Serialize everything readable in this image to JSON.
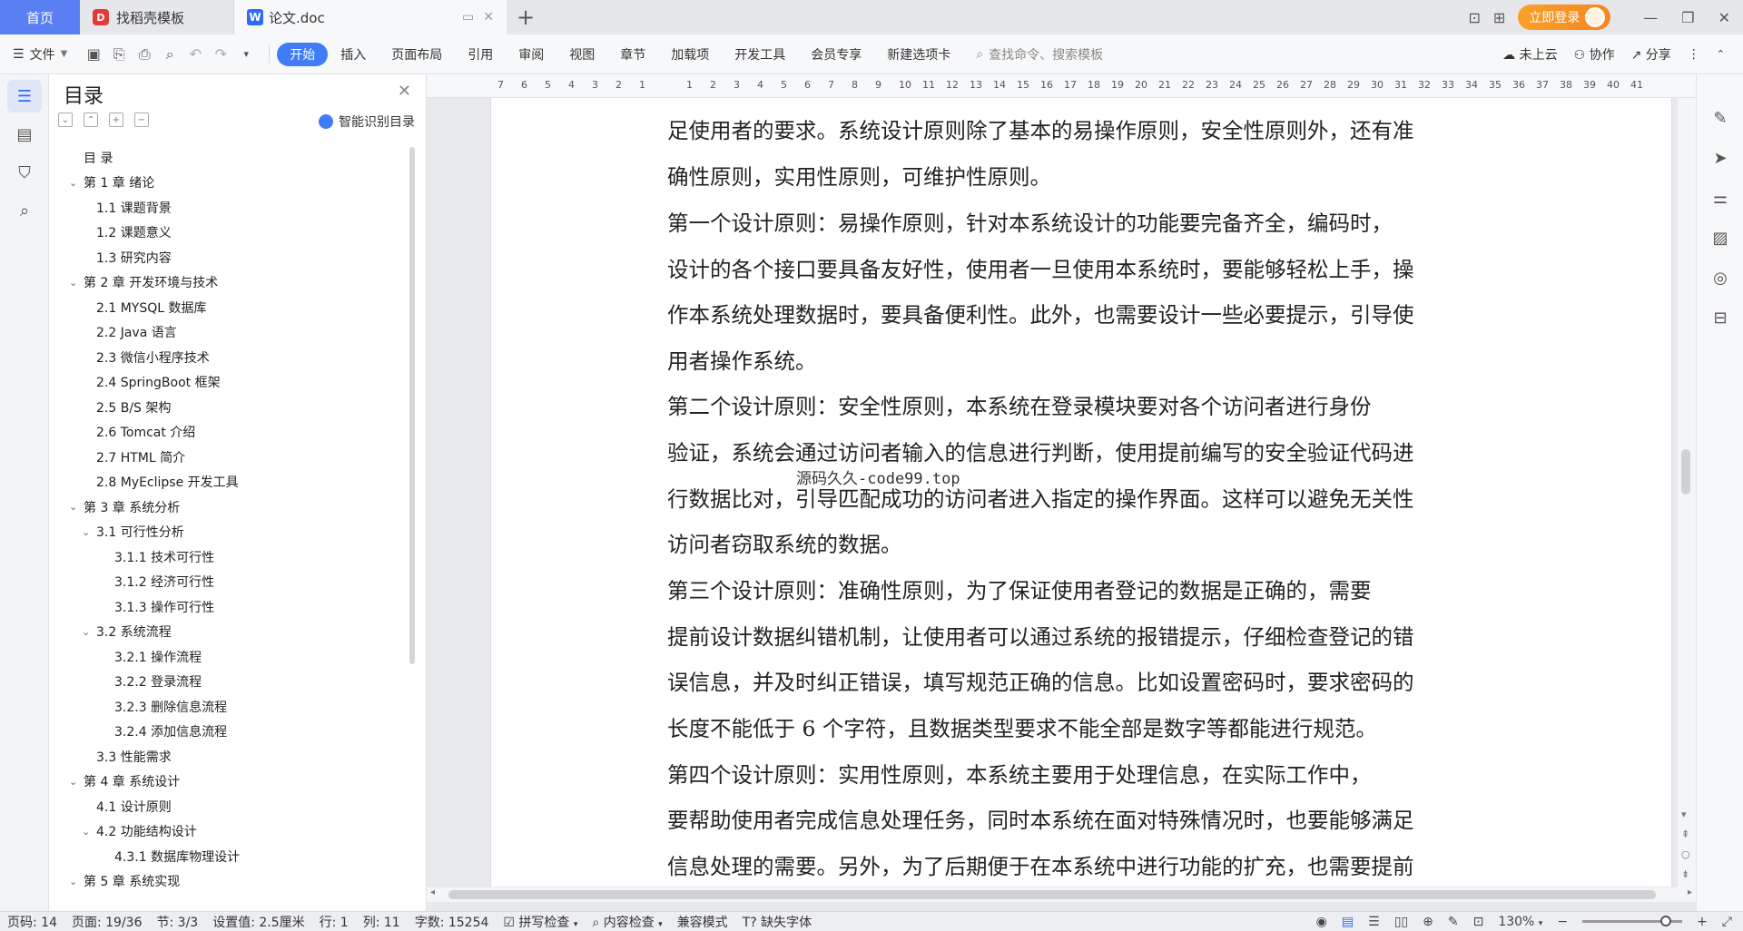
{
  "tabs": {
    "home": "首页",
    "template": "找稻壳模板",
    "document": "论文.doc",
    "add": "+"
  },
  "titlebar": {
    "login": "立即登录"
  },
  "toolbar": {
    "file_menu": "文件",
    "ribbon": [
      "开始",
      "插入",
      "页面布局",
      "引用",
      "审阅",
      "视图",
      "章节",
      "加载项",
      "开发工具",
      "会员专享",
      "新建选项卡"
    ],
    "search_placeholder": "查找命令、搜索模板",
    "cloud": "未上云",
    "collab": "协作",
    "share": "分享"
  },
  "toc": {
    "title": "目录",
    "smart_button": "智能识别目录",
    "items": [
      "目  录",
      "第 1 章  绪论",
      "1.1  课题背景",
      "1.2  课题意义",
      "1.3  研究内容",
      "第 2 章  开发环境与技术",
      "2.1 MYSQL 数据库",
      "2.2 Java 语言",
      "2.3  微信小程序技术",
      "2.4 SpringBoot 框架",
      "2.5 B/S 架构",
      "2.6 Tomcat  介绍",
      "2.7 HTML 简介",
      "2.8 MyEclipse 开发工具",
      "第 3 章  系统分析",
      "3.1  可行性分析",
      "3.1.1  技术可行性",
      "3.1.2  经济可行性",
      "3.1.3  操作可行性",
      "3.2  系统流程",
      "3.2.1  操作流程",
      "3.2.2  登录流程",
      "3.2.3  删除信息流程",
      "3.2.4  添加信息流程",
      "3.3  性能需求",
      "第 4 章  系统设计",
      "4.1  设计原则",
      "4.2  功能结构设计",
      "4.3.1  数据库物理设计",
      "第 5 章  系统实现"
    ]
  },
  "ruler_labels": [
    "7",
    "6",
    "5",
    "4",
    "3",
    "2",
    "1",
    "",
    "1",
    "2",
    "3",
    "4",
    "5",
    "6",
    "7",
    "8",
    "9",
    "10",
    "11",
    "12",
    "13",
    "14",
    "15",
    "16",
    "17",
    "18",
    "19",
    "20",
    "21",
    "22",
    "23",
    "24",
    "25",
    "26",
    "27",
    "28",
    "29",
    "30",
    "31",
    "32",
    "33",
    "34",
    "35",
    "36",
    "37",
    "38",
    "39",
    "40",
    "41"
  ],
  "document": {
    "lines": [
      "足使用者的要求。系统设计原则除了基本的易操作原则，安全性原则外，还有准",
      "确性原则，实用性原则，可维护性原则。",
      "    第一个设计原则：易操作原则，针对本系统设计的功能要完备齐全，编码时，",
      "设计的各个接口要具备友好性，使用者一旦使用本系统时，要能够轻松上手，操",
      "作本系统处理数据时，要具备便利性。此外，也需要设计一些必要提示，引导使",
      "用者操作系统。",
      "    第二个设计原则：安全性原则，本系统在登录模块要对各个访问者进行身份",
      "验证，系统会通过访问者输入的信息进行判断，使用提前编写的安全验证代码进",
      "行数据比对，引导匹配成功的访问者进入指定的操作界面。这样可以避免无关性",
      "访问者窃取系统的数据。",
      "    第三个设计原则：准确性原则，为了保证使用者登记的数据是正确的，需要",
      "提前设计数据纠错机制，让使用者可以通过系统的报错提示，仔细检查登记的错",
      "误信息，并及时纠正错误，填写规范正确的信息。比如设置密码时，要求密码的",
      "长度不能低于 6 个字符，且数据类型要求不能全部是数字等都能进行规范。",
      "    第四个设计原则：实用性原则，本系统主要用于处理信息，在实际工作中，",
      "要帮助使用者完成信息处理任务，同时本系统在面对特殊情况时，也要能够满足",
      "信息处理的需要。另外，为了后期便于在本系统中进行功能的扩充，也需要提前"
    ],
    "watermark": "源码久久-code99.top"
  },
  "status": {
    "page_code": "页码: 14",
    "page": "页面: 19/36",
    "section": "节: 3/3",
    "setting": "设置值: 2.5厘米",
    "row": "行: 1",
    "col": "列: 11",
    "words": "字数: 15254",
    "spell": "拼写检查",
    "content_check": "内容检查",
    "compat": "兼容模式",
    "missing_font": "缺失字体",
    "zoom": "130%"
  }
}
